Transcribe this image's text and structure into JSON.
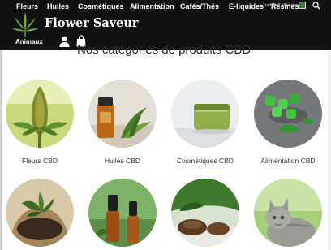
{
  "nav": {
    "items": [
      "Fleurs",
      "Huiles",
      "Cosmétiques",
      "Alimentation",
      "Cafés/Thés",
      "E-liquides",
      "Résines"
    ],
    "second_row_item": "Animaux"
  },
  "language": {
    "label": "Traduire / Thenaisselpa"
  },
  "brand": {
    "name": "Flower Saveur"
  },
  "section": {
    "title": "Nos catégories de produits CBD"
  },
  "categories": [
    {
      "label": "Fleurs CBD"
    },
    {
      "label": "Huiles CBD"
    },
    {
      "label": "Cosmétiques CBD"
    },
    {
      "label": "Alimentation CBD"
    },
    {
      "label": ""
    },
    {
      "label": ""
    },
    {
      "label": ""
    },
    {
      "label": ""
    }
  ],
  "icons": [
    "cannabis-leaf-logo-icon",
    "user-icon",
    "shopping-bag-icon",
    "search-icon",
    "flag-icon"
  ],
  "colors": {
    "topbar": "#111111",
    "accent_green": "#3b7a3b",
    "text": "#333333"
  }
}
